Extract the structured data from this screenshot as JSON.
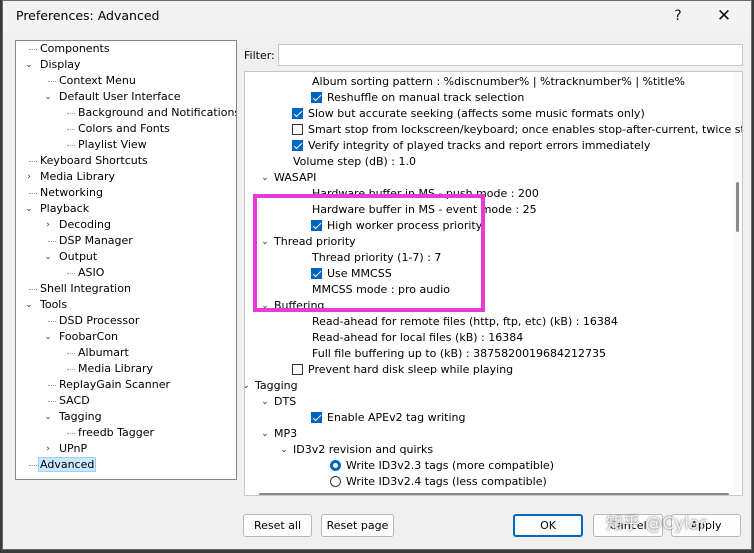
{
  "window": {
    "title": "Preferences: Advanced",
    "help_glyph": "?",
    "close_glyph": "✕"
  },
  "tree": [
    {
      "label": "Components",
      "depth": 0,
      "toggle": ""
    },
    {
      "label": "Display",
      "depth": 0,
      "toggle": "v"
    },
    {
      "label": "Context Menu",
      "depth": 1,
      "toggle": ""
    },
    {
      "label": "Default User Interface",
      "depth": 1,
      "toggle": "v"
    },
    {
      "label": "Background and Notifications",
      "depth": 2,
      "toggle": ""
    },
    {
      "label": "Colors and Fonts",
      "depth": 2,
      "toggle": ""
    },
    {
      "label": "Playlist View",
      "depth": 2,
      "toggle": ""
    },
    {
      "label": "Keyboard Shortcuts",
      "depth": 0,
      "toggle": ""
    },
    {
      "label": "Media Library",
      "depth": 0,
      "toggle": ">"
    },
    {
      "label": "Networking",
      "depth": 0,
      "toggle": ""
    },
    {
      "label": "Playback",
      "depth": 0,
      "toggle": "v"
    },
    {
      "label": "Decoding",
      "depth": 1,
      "toggle": ">"
    },
    {
      "label": "DSP Manager",
      "depth": 1,
      "toggle": ""
    },
    {
      "label": "Output",
      "depth": 1,
      "toggle": "v"
    },
    {
      "label": "ASIO",
      "depth": 2,
      "toggle": ""
    },
    {
      "label": "Shell Integration",
      "depth": 0,
      "toggle": ""
    },
    {
      "label": "Tools",
      "depth": 0,
      "toggle": "v"
    },
    {
      "label": "DSD Processor",
      "depth": 1,
      "toggle": ""
    },
    {
      "label": "FoobarCon",
      "depth": 1,
      "toggle": "v"
    },
    {
      "label": "Albumart",
      "depth": 2,
      "toggle": ""
    },
    {
      "label": "Media Library",
      "depth": 2,
      "toggle": ""
    },
    {
      "label": "ReplayGain Scanner",
      "depth": 1,
      "toggle": ""
    },
    {
      "label": "SACD",
      "depth": 1,
      "toggle": ""
    },
    {
      "label": "Tagging",
      "depth": 1,
      "toggle": "v"
    },
    {
      "label": "freedb Tagger",
      "depth": 2,
      "toggle": ""
    },
    {
      "label": "UPnP",
      "depth": 1,
      "toggle": ">"
    },
    {
      "label": "Advanced",
      "depth": 0,
      "toggle": "",
      "selected": true
    }
  ],
  "filter": {
    "label": "Filter:",
    "value": ""
  },
  "settings": [
    {
      "kind": "text",
      "text": "Album sorting pattern : %discnumber% | %tracknumber% | %title%",
      "level": 3
    },
    {
      "kind": "check",
      "checked": true,
      "text": "Reshuffle on manual track selection",
      "level": 3
    },
    {
      "kind": "check",
      "checked": true,
      "text": "Slow but accurate seeking (affects some music formats only)",
      "level": 2
    },
    {
      "kind": "check",
      "checked": false,
      "text": "Smart stop from lockscreen/keyboard; once enables stop-after-current, twice stops",
      "level": 2
    },
    {
      "kind": "check",
      "checked": true,
      "text": "Verify integrity of played tracks and report errors immediately",
      "level": 2
    },
    {
      "kind": "text",
      "text": "Volume step (dB) : 1.0",
      "level": 2
    },
    {
      "kind": "group",
      "text": "WASAPI",
      "level": 1
    },
    {
      "kind": "text",
      "text": "Hardware buffer in MS - push mode : 200",
      "level": 3
    },
    {
      "kind": "text",
      "text": "Hardware buffer in MS - event mode : 25",
      "level": 3
    },
    {
      "kind": "check",
      "checked": true,
      "text": "High worker process priority",
      "level": 3
    },
    {
      "kind": "group",
      "text": "Thread priority",
      "level": 1
    },
    {
      "kind": "text",
      "text": "Thread priority (1-7) : 7",
      "level": 3
    },
    {
      "kind": "check",
      "checked": true,
      "text": "Use MMCSS",
      "level": 3
    },
    {
      "kind": "text",
      "text": "MMCSS mode : pro audio",
      "level": 3
    },
    {
      "kind": "group",
      "text": "Buffering",
      "level": 1
    },
    {
      "kind": "text",
      "text": "Read-ahead for remote files (http, ftp, etc) (kB) : 16384",
      "level": 3
    },
    {
      "kind": "text",
      "text": "Read-ahead for local files (kB) : 16384",
      "level": 3
    },
    {
      "kind": "text",
      "text": "Full file buffering up to (kB) : 3875820019684212735",
      "level": 3
    },
    {
      "kind": "check",
      "checked": false,
      "text": "Prevent hard disk sleep while playing",
      "level": 2
    },
    {
      "kind": "group",
      "text": "Tagging",
      "level": 0
    },
    {
      "kind": "group",
      "text": "DTS",
      "level": 1
    },
    {
      "kind": "check",
      "checked": true,
      "text": "Enable APEv2 tag writing",
      "level": 3
    },
    {
      "kind": "group",
      "text": "MP3",
      "level": 1
    },
    {
      "kind": "group",
      "text": "ID3v2 revision and quirks",
      "level": 2
    },
    {
      "kind": "radio",
      "checked": true,
      "text": "Write ID3v2.3 tags (more compatible)",
      "level": 4
    },
    {
      "kind": "radio",
      "checked": false,
      "text": "Write ID3v2.4 tags (less compatible)",
      "level": 4
    }
  ],
  "buttons": {
    "reset_all": "Reset all",
    "reset_page": "Reset page",
    "ok": "OK",
    "cancel": "Cancel",
    "apply": "Apply"
  },
  "watermark": "知乎 @Cylar",
  "colors": {
    "accent": "#0067c0",
    "highlight_box": "#e83ad6",
    "selection": "#cce8ff"
  }
}
